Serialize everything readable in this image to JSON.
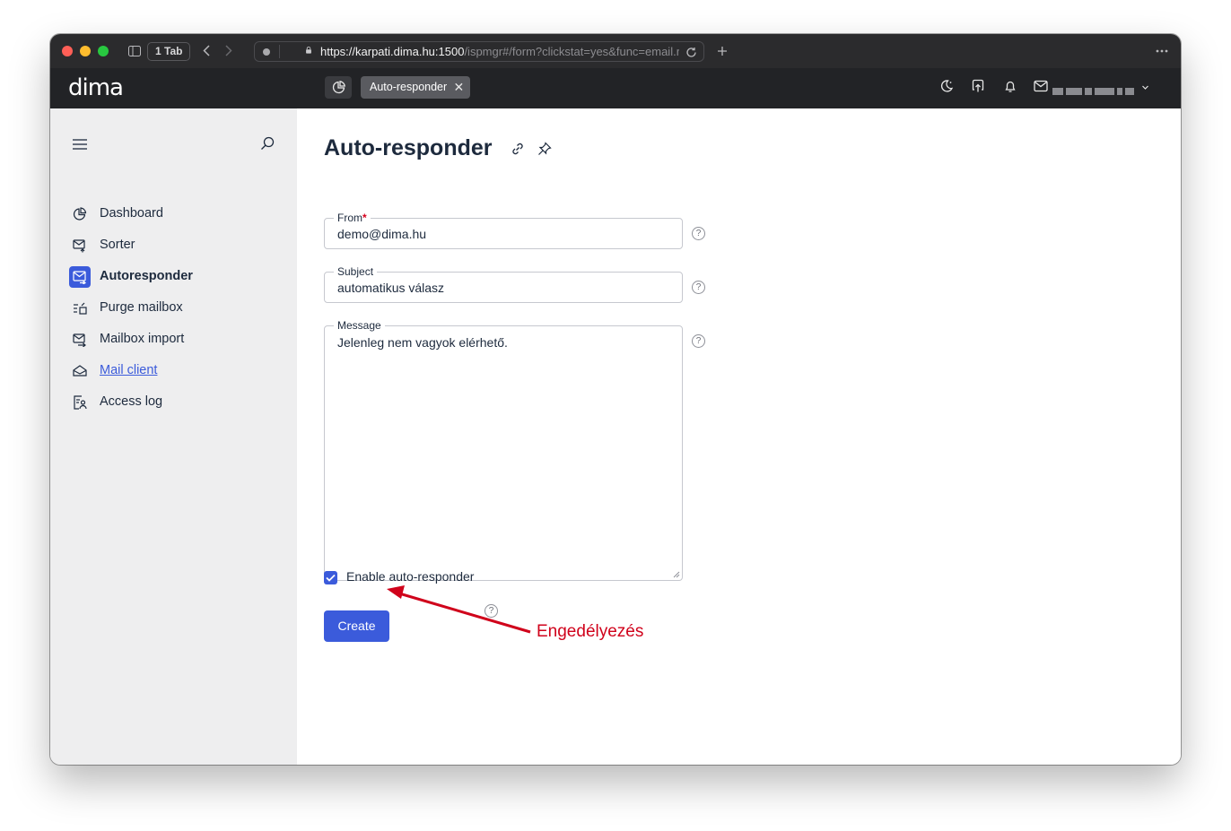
{
  "browser": {
    "tab_count": "1 Tab",
    "url_main": "https://karpati.dima.hu:1500",
    "url_rest": "/ispmgr#/form?clickstat=yes&func=email.responder.edit&elid=demo@dima.hu"
  },
  "header": {
    "logo": "dima",
    "active_tab": "Auto-responder"
  },
  "sidebar": {
    "items": [
      {
        "label": "Dashboard"
      },
      {
        "label": "Sorter"
      },
      {
        "label": "Autoresponder"
      },
      {
        "label": "Purge mailbox"
      },
      {
        "label": "Mailbox import"
      },
      {
        "label": "Mail client"
      },
      {
        "label": "Access log"
      }
    ]
  },
  "form": {
    "title": "Auto-responder",
    "from_label": "From",
    "from_required": "*",
    "from_value": "demo@dima.hu",
    "subject_label": "Subject",
    "subject_value": "automatikus válasz",
    "message_label": "Message",
    "message_value": "Jelenleg nem vagyok elérhető.",
    "enable_label": "Enable auto-responder",
    "enable_checked": true,
    "create_label": "Create",
    "help_glyph": "?"
  },
  "annotation": {
    "text": "Engedélyezés",
    "color": "#d0021b"
  },
  "colors": {
    "accent": "#3b5bdb",
    "header_bg": "#222326",
    "sidebar_bg": "#eeeeef"
  }
}
